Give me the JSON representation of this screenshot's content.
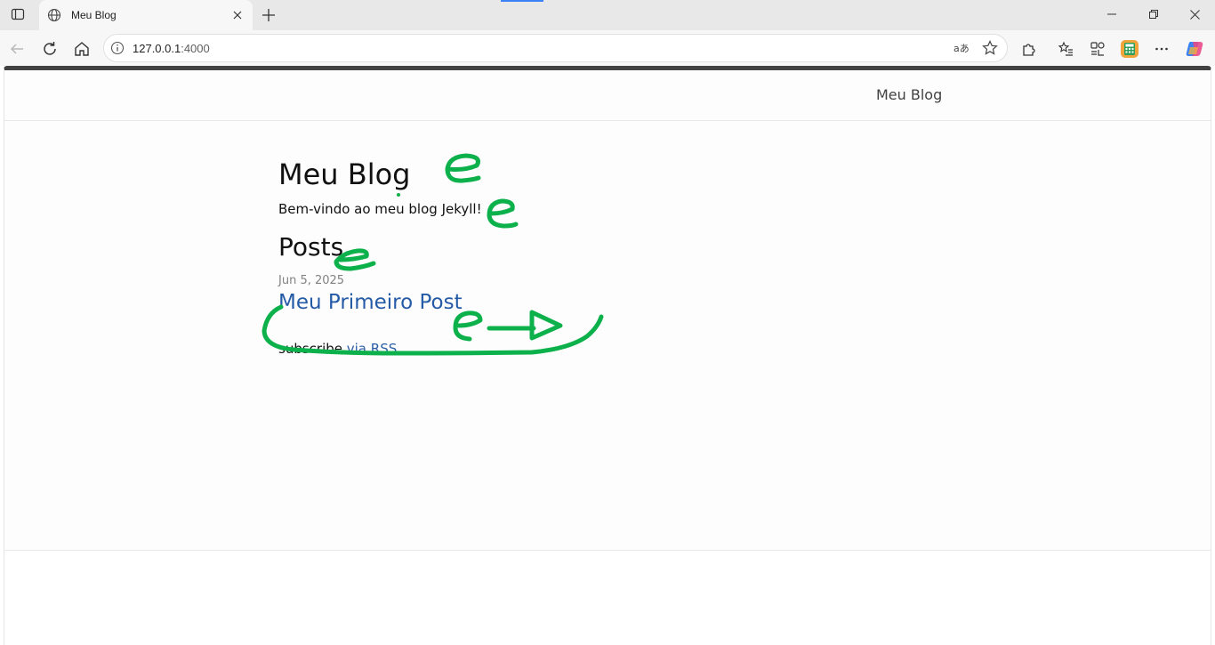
{
  "browser": {
    "tab_title": "Meu Blog",
    "url_host": "127.0.0.1",
    "url_port": ":4000",
    "accent": "#3b82f6"
  },
  "icons": {
    "tab_actions": "vertical-tabs-icon",
    "favicon": "globe-icon",
    "tab_close": "close-icon",
    "new_tab": "plus-icon",
    "minimize": "minimize-icon",
    "restore": "restore-icon",
    "close_window": "close-icon",
    "back": "back-arrow-icon",
    "reload": "reload-icon",
    "home": "home-icon",
    "site_info": "info-icon",
    "translate": "translate-icon",
    "favorite": "star-icon",
    "extensions": "puzzle-icon",
    "favorites": "favorites-list-icon",
    "collections": "collections-icon",
    "calculator": "calculator-icon",
    "more": "more-icon",
    "copilot": "copilot-icon"
  },
  "site": {
    "title": "Meu Blog"
  },
  "page": {
    "heading": "Meu Blog",
    "intro": "Bem-vindo ao meu blog Jekyll!",
    "posts_heading": "Posts",
    "posts": [
      {
        "date": "Jun 5, 2025",
        "title": "Meu Primeiro Post"
      }
    ],
    "rss_prefix": "subscribe ",
    "rss_link": "via RSS"
  },
  "colors": {
    "link": "#245aa6",
    "annotation_ink": "#0db14b",
    "header_bar": "#424242"
  }
}
